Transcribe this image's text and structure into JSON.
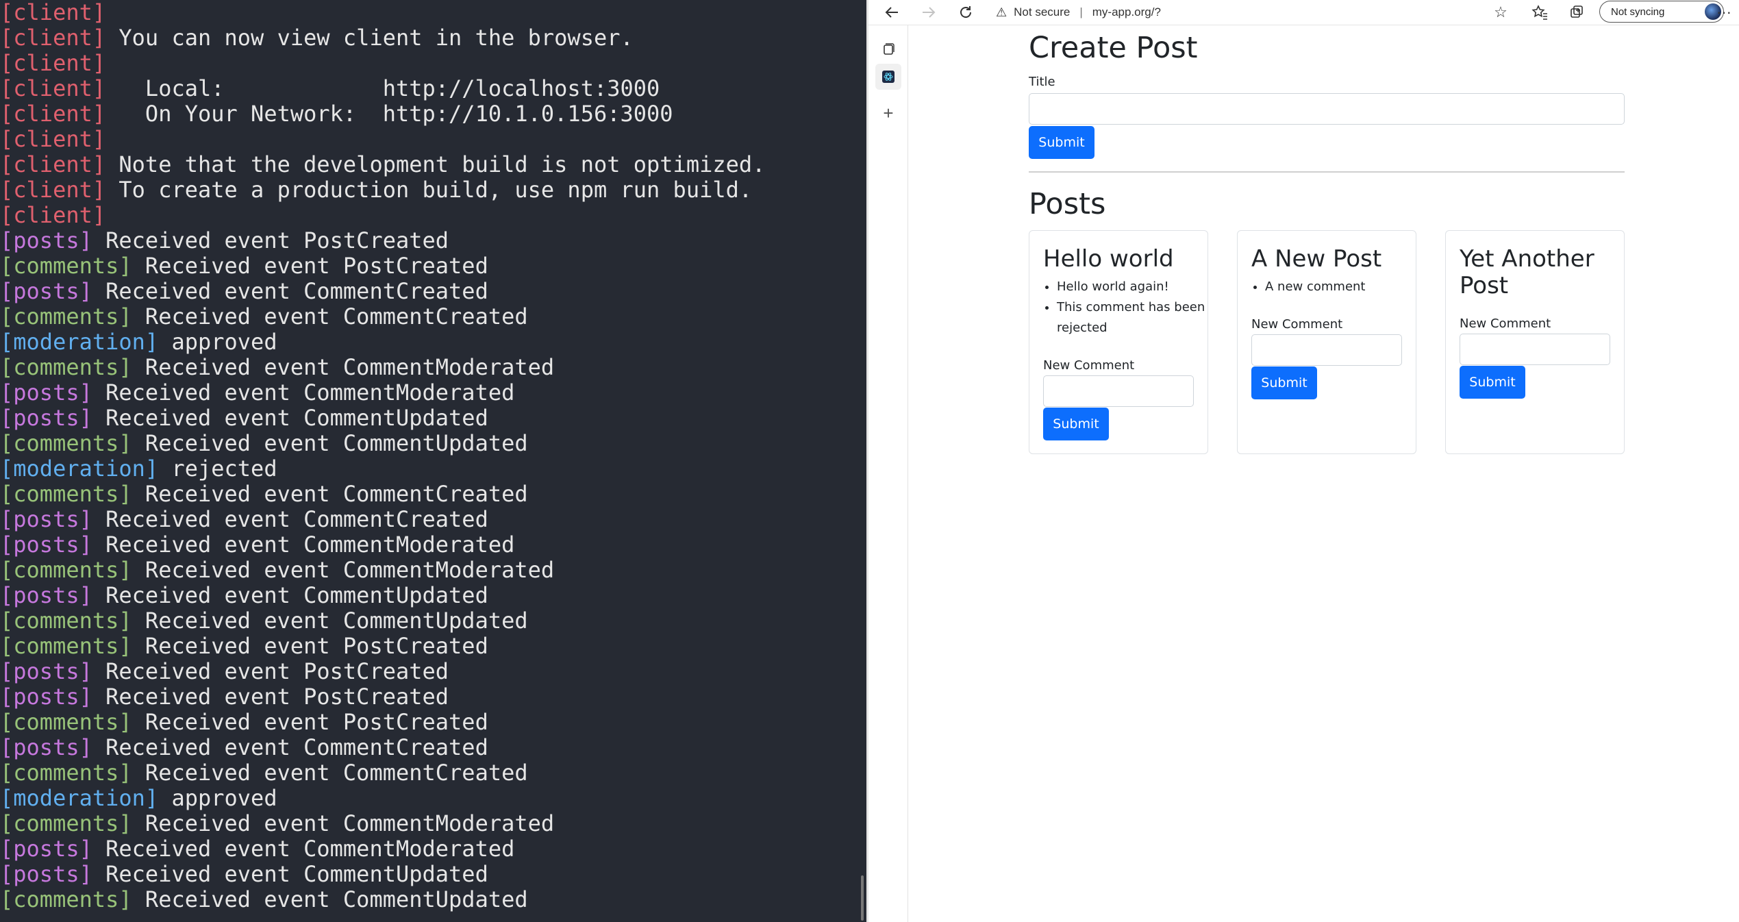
{
  "terminal": {
    "lines": [
      {
        "tag": "[client]",
        "kind": "client",
        "text": ""
      },
      {
        "tag": "[client]",
        "kind": "client",
        "text": " You can now view client in the browser."
      },
      {
        "tag": "[client]",
        "kind": "client",
        "text": ""
      },
      {
        "tag": "[client]",
        "kind": "client",
        "text": "   Local:            http://localhost:3000"
      },
      {
        "tag": "[client]",
        "kind": "client",
        "text": "   On Your Network:  http://10.1.0.156:3000"
      },
      {
        "tag": "[client]",
        "kind": "client",
        "text": ""
      },
      {
        "tag": "[client]",
        "kind": "client",
        "text": " Note that the development build is not optimized."
      },
      {
        "tag": "[client]",
        "kind": "client",
        "text": " To create a production build, use npm run build."
      },
      {
        "tag": "[client]",
        "kind": "client",
        "text": ""
      },
      {
        "tag": "[posts]",
        "kind": "posts",
        "text": " Received event PostCreated"
      },
      {
        "tag": "[comments]",
        "kind": "comments",
        "text": " Received event PostCreated"
      },
      {
        "tag": "[posts]",
        "kind": "posts",
        "text": " Received event CommentCreated"
      },
      {
        "tag": "[comments]",
        "kind": "comments",
        "text": " Received event CommentCreated"
      },
      {
        "tag": "[moderation]",
        "kind": "moderation",
        "text": " approved"
      },
      {
        "tag": "[comments]",
        "kind": "comments",
        "text": " Received event CommentModerated"
      },
      {
        "tag": "[posts]",
        "kind": "posts",
        "text": " Received event CommentModerated"
      },
      {
        "tag": "[posts]",
        "kind": "posts",
        "text": " Received event CommentUpdated"
      },
      {
        "tag": "[comments]",
        "kind": "comments",
        "text": " Received event CommentUpdated"
      },
      {
        "tag": "[moderation]",
        "kind": "moderation",
        "text": " rejected"
      },
      {
        "tag": "[comments]",
        "kind": "comments",
        "text": " Received event CommentCreated"
      },
      {
        "tag": "[posts]",
        "kind": "posts",
        "text": " Received event CommentCreated"
      },
      {
        "tag": "[posts]",
        "kind": "posts",
        "text": " Received event CommentModerated"
      },
      {
        "tag": "[comments]",
        "kind": "comments",
        "text": " Received event CommentModerated"
      },
      {
        "tag": "[posts]",
        "kind": "posts",
        "text": " Received event CommentUpdated"
      },
      {
        "tag": "[comments]",
        "kind": "comments",
        "text": " Received event CommentUpdated"
      },
      {
        "tag": "[comments]",
        "kind": "comments",
        "text": " Received event PostCreated"
      },
      {
        "tag": "[posts]",
        "kind": "posts",
        "text": " Received event PostCreated"
      },
      {
        "tag": "[posts]",
        "kind": "posts",
        "text": " Received event PostCreated"
      },
      {
        "tag": "[comments]",
        "kind": "comments",
        "text": " Received event PostCreated"
      },
      {
        "tag": "[posts]",
        "kind": "posts",
        "text": " Received event CommentCreated"
      },
      {
        "tag": "[comments]",
        "kind": "comments",
        "text": " Received event CommentCreated"
      },
      {
        "tag": "[moderation]",
        "kind": "moderation",
        "text": " approved"
      },
      {
        "tag": "[comments]",
        "kind": "comments",
        "text": " Received event CommentModerated"
      },
      {
        "tag": "[posts]",
        "kind": "posts",
        "text": " Received event CommentModerated"
      },
      {
        "tag": "[posts]",
        "kind": "posts",
        "text": " Received event CommentUpdated"
      },
      {
        "tag": "[comments]",
        "kind": "comments",
        "text": " Received event CommentUpdated"
      }
    ],
    "colors": {
      "background": "#262a33",
      "client": "#e0606e",
      "posts": "#c678dd",
      "comments": "#98c379",
      "moderation": "#61afef"
    }
  },
  "browser": {
    "toolbar": {
      "back_icon": "back-arrow-icon",
      "forward_icon": "forward-arrow-icon",
      "refresh_icon": "refresh-icon",
      "security_warning": "Not secure",
      "url": "my-app.org/?",
      "sync_label": "Not syncing"
    },
    "sidebar_icons": [
      "tab-actions-icon",
      "react-devtools-icon",
      "add-icon"
    ]
  },
  "page": {
    "create_post": {
      "heading": "Create Post",
      "title_label": "Title",
      "title_value": "",
      "submit_label": "Submit"
    },
    "posts_heading": "Posts",
    "posts": [
      {
        "title": "Hello world",
        "comments": [
          "Hello world again!",
          "This comment has been rejected"
        ],
        "new_comment_label": "New Comment",
        "new_comment_value": "",
        "submit_label": "Submit"
      },
      {
        "title": "A New Post",
        "comments": [
          "A new comment"
        ],
        "new_comment_label": "New Comment",
        "new_comment_value": "",
        "submit_label": "Submit"
      },
      {
        "title": "Yet Another Post",
        "comments": [],
        "new_comment_label": "New Comment",
        "new_comment_value": "",
        "submit_label": "Submit"
      }
    ],
    "accent_color": "#0d6efd"
  }
}
